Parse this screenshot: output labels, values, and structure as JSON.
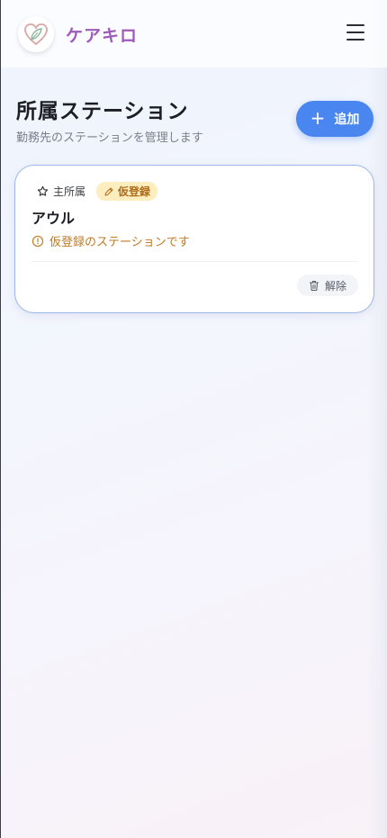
{
  "app": {
    "brand": "ケアキロ"
  },
  "page": {
    "title": "所属ステーション",
    "subtitle": "勤務先のステーションを管理します",
    "add_label": "追加"
  },
  "stations": [
    {
      "primary_label": "主所属",
      "status_label": "仮登録",
      "name": "アウル",
      "notice": "仮登録のステーションです",
      "release_label": "解除"
    }
  ],
  "colors": {
    "brand": "#9c5cb8",
    "accent": "#4a86f0",
    "warning": "#c07a28",
    "warning_bg": "#fdeec0"
  },
  "icons": {
    "logo": "heart-leaf-logo",
    "menu": "hamburger-menu-icon",
    "add": "plus-icon",
    "primary": "star-icon",
    "status": "pencil-icon",
    "notice": "alert-circle-icon",
    "release": "trash-icon"
  }
}
